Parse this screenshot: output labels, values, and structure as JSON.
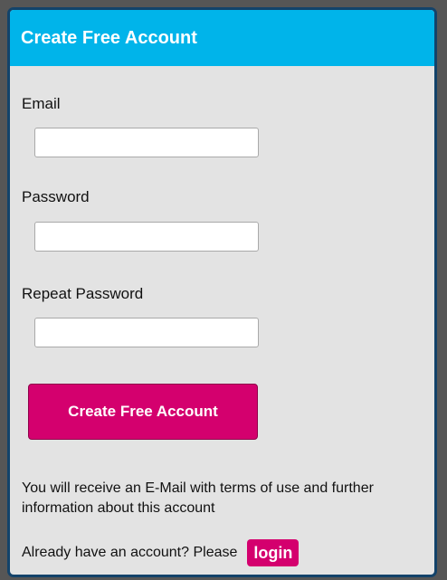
{
  "form": {
    "title": "Create Free Account",
    "fields": [
      {
        "label": "Email",
        "value": "",
        "placeholder": ""
      },
      {
        "label": "Password",
        "value": "",
        "placeholder": ""
      },
      {
        "label": "Repeat Password",
        "value": "",
        "placeholder": ""
      }
    ],
    "submit_label": "Create Free Account",
    "info_text": "You will receive an E-Mail with terms of use and further information about this account",
    "login_prompt": "Already have an account? Please",
    "login_label": "login"
  },
  "colors": {
    "header": "#00b4ea",
    "panel_background": "#e3e3e3",
    "panel_border": "#13436a",
    "accent": "#d4006e"
  }
}
